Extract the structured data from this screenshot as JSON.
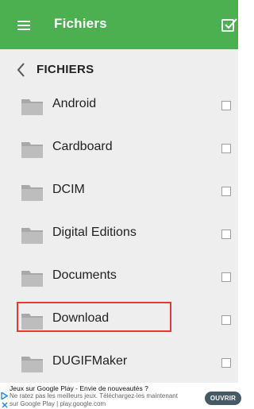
{
  "appbar": {
    "title": "Fichiers",
    "menu_icon": "hamburger-menu-icon",
    "select_icon": "checkbox-select-icon"
  },
  "breadcrumb": {
    "label": "FICHIERS",
    "back_icon": "chevron-left-icon"
  },
  "folders": [
    {
      "name": "Android",
      "selected": false
    },
    {
      "name": "Cardboard",
      "selected": false
    },
    {
      "name": "DCIM",
      "selected": false
    },
    {
      "name": "Digital Editions",
      "selected": false
    },
    {
      "name": "Documents",
      "selected": false
    },
    {
      "name": "Download",
      "selected": false,
      "highlighted": true
    },
    {
      "name": "DUGIFMaker",
      "selected": false
    }
  ],
  "ad": {
    "title": "Jeux sur Google Play - Envie de nouveautés ?",
    "body": "Ne ratez pas les meilleurs jeux. Téléchargez-les maintenant sur Google Play | play.google.com",
    "cta": "OUVRIR"
  },
  "colors": {
    "appbar": "#4caf50",
    "list_bg": "#eeeeee",
    "highlight": "#e53935",
    "cta_bg": "#455a64"
  }
}
